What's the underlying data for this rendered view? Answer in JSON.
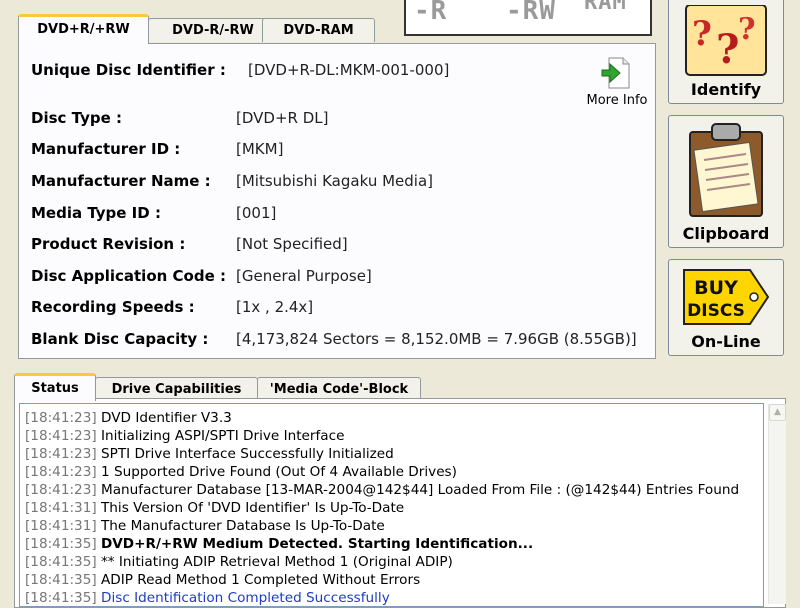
{
  "logo": {
    "text_left": "-R",
    "text_mid": "-RW",
    "text_right": "RAM"
  },
  "top_tabs": [
    {
      "label": "DVD+R/+RW",
      "active": true
    },
    {
      "label": "DVD-R/-RW",
      "active": false
    },
    {
      "label": "DVD-RAM",
      "active": false
    }
  ],
  "disc_info": {
    "unique_id": {
      "label": "Unique Disc Identifier :",
      "value": "[DVD+R-DL:MKM-001-000]"
    },
    "more_info_label": "More Info",
    "fields": [
      {
        "label": "Disc Type :",
        "value": "[DVD+R DL]"
      },
      {
        "label": "Manufacturer ID :",
        "value": "[MKM]"
      },
      {
        "label": "Manufacturer Name :",
        "value": "[Mitsubishi Kagaku Media]"
      },
      {
        "label": "Media Type ID :",
        "value": "[001]"
      },
      {
        "label": "Product Revision :",
        "value": "[Not Specified]"
      },
      {
        "label": "Disc Application Code :",
        "value": "[General Purpose]"
      },
      {
        "label": "Recording Speeds :",
        "value": "[1x , 2.4x]"
      },
      {
        "label": "Blank Disc Capacity :",
        "value": "[4,173,824 Sectors = 8,152.0MB = 7.96GB (8.55GB)]"
      }
    ]
  },
  "side_buttons": {
    "identify": "Identify",
    "clipboard": "Clipboard",
    "buy_line1": "BUY",
    "buy_line2": "DISCS",
    "online": "On-Line"
  },
  "bottom_tabs": [
    {
      "label": "Status",
      "active": true
    },
    {
      "label": "Drive Capabilities",
      "active": false
    },
    {
      "label": "'Media Code'-Block",
      "active": false
    }
  ],
  "log": [
    {
      "ts": "[18:41:23]",
      "msg": "DVD Identifier V3.3"
    },
    {
      "ts": "[18:41:23]",
      "msg": "Initializing ASPI/SPTI Drive Interface"
    },
    {
      "ts": "[18:41:23]",
      "msg": "SPTI Drive Interface Successfully Initialized"
    },
    {
      "ts": "[18:41:23]",
      "msg": "1 Supported Drive Found (Out Of 4 Available Drives)"
    },
    {
      "ts": "[18:41:23]",
      "msg": "Manufacturer Database [13-MAR-2004@142$44] Loaded From File : (@142$44) Entries Found"
    },
    {
      "ts": "[18:41:31]",
      "msg": "This Version Of 'DVD Identifier' Is Up-To-Date"
    },
    {
      "ts": "[18:41:31]",
      "msg": "The Manufacturer Database Is Up-To-Date"
    },
    {
      "ts": "[18:41:35]",
      "msg": "DVD+R/+RW Medium Detected. Starting Identification..."
    },
    {
      "ts": "[18:41:35]",
      "msg": "** Initiating ADIP Retrieval Method 1 (Original ADIP)"
    },
    {
      "ts": "[18:41:35]",
      "msg": "ADIP Read Method 1 Completed Without Errors"
    },
    {
      "ts": "[18:41:35]",
      "msg": "Disc Identification Completed Successfully"
    }
  ],
  "colors": {
    "accent_tab": "#ffc83c",
    "log_highlight": "#1a3ec8",
    "window_bg": "#ece9d8"
  }
}
